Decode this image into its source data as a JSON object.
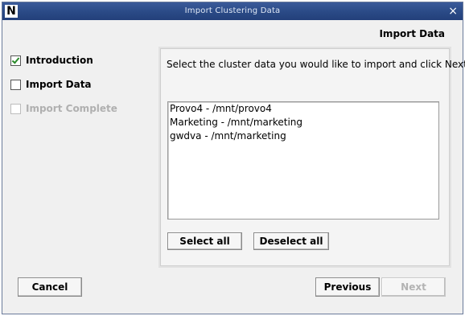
{
  "window": {
    "title": "Import Clustering Data",
    "logo": "N",
    "close": "×"
  },
  "header": {
    "title": "Import Data"
  },
  "steps": [
    {
      "label": "Introduction",
      "state": "checked"
    },
    {
      "label": "Import Data",
      "state": "unchecked"
    },
    {
      "label": "Import Complete",
      "state": "disabled"
    }
  ],
  "main": {
    "instruction": "Select the cluster data you would like to import and click Next.",
    "cluster_list": [
      "Provo4 - /mnt/provo4",
      "Marketing - /mnt/marketing",
      "gwdva - /mnt/marketing"
    ],
    "select_all_label": "Select all",
    "deselect_all_label": "Deselect all"
  },
  "footer": {
    "cancel_label": "Cancel",
    "previous_label": "Previous",
    "next_label": "Next"
  },
  "colors": {
    "titlebar": "#2a4a86",
    "check": "#2a8a2a",
    "disabled_text": "#b0b0b0"
  }
}
